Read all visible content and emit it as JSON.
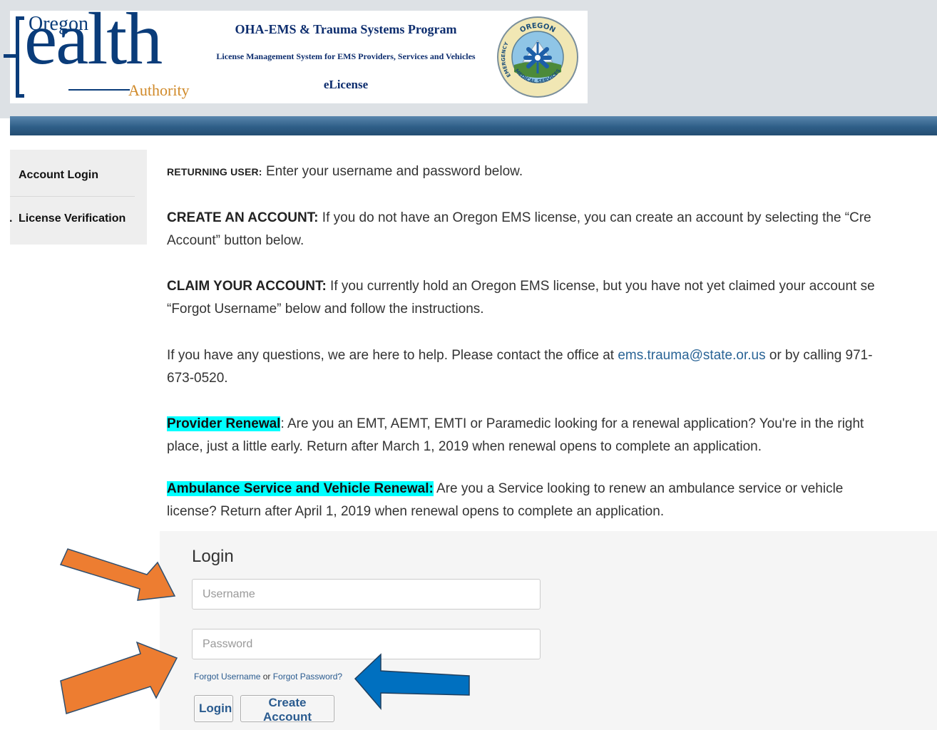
{
  "header": {
    "logo": {
      "oregon": "Oregon",
      "ealth": "ealth",
      "authority": "Authority"
    },
    "program_title": "OHA-EMS & Trauma Systems Program",
    "system_subtitle": "License Management System for EMS Providers, Services and Vehicles",
    "app_name": "eLicense",
    "seal": {
      "top_text": "OREGON",
      "left_text": "EMERGENCY",
      "bottom_text": "MEDICAL SERVICES"
    }
  },
  "sidebar": {
    "items": [
      {
        "label": "Account Login"
      },
      {
        "label": "License Verification"
      }
    ]
  },
  "content": {
    "returning_label": "RETURNING USER:",
    "returning_text": " Enter your username and password below.",
    "create_label": "CREATE AN ACCOUNT:",
    "create_text_1": " If you do not have an Oregon EMS license, you can create an account by selecting the “Cre",
    "create_text_2": "Account” button below.",
    "claim_label": "CLAIM YOUR ACCOUNT:",
    "claim_text_1": " If you currently hold an Oregon EMS license, but you have not yet claimed your account se",
    "claim_text_2": "“Forgot Username” below and follow the instructions.",
    "help_text_1": "If you have any questions, we are here to help. Please contact the office at ",
    "help_email": "ems.trauma@state.or.us",
    "help_text_2": " or by calling 971-",
    "help_text_3": "673-0520.",
    "provider_label": "Provider Renewal",
    "provider_text_1": ": Are you an EMT, AEMT, EMTI or Paramedic looking for a renewal application? You're in the right",
    "provider_text_2": "place, just a little early. Return after March 1, 2019 when renewal opens to complete an application.",
    "ambulance_label": "Ambulance Service and Vehicle Renewal:",
    "ambulance_text_1": " Are you a Service looking to renew an ambulance service or vehicle",
    "ambulance_text_2": "license?  Return after April 1, 2019 when renewal opens to complete an application."
  },
  "login": {
    "title": "Login",
    "username_placeholder": "Username",
    "password_placeholder": "Password",
    "forgot_username": "Forgot Username",
    "or": " or ",
    "forgot_password": "Forgot Password?",
    "login_button": "Login",
    "create_button": "Create Account"
  },
  "colors": {
    "highlight": "#00ffff",
    "annotation_orange": "#ed7d31",
    "annotation_blue": "#0070c0",
    "header_bar": "#2f5f88",
    "link": "#2a6496"
  },
  "icons": [
    "orange-arrow-icon",
    "blue-arrow-icon",
    "ems-seal-icon"
  ]
}
